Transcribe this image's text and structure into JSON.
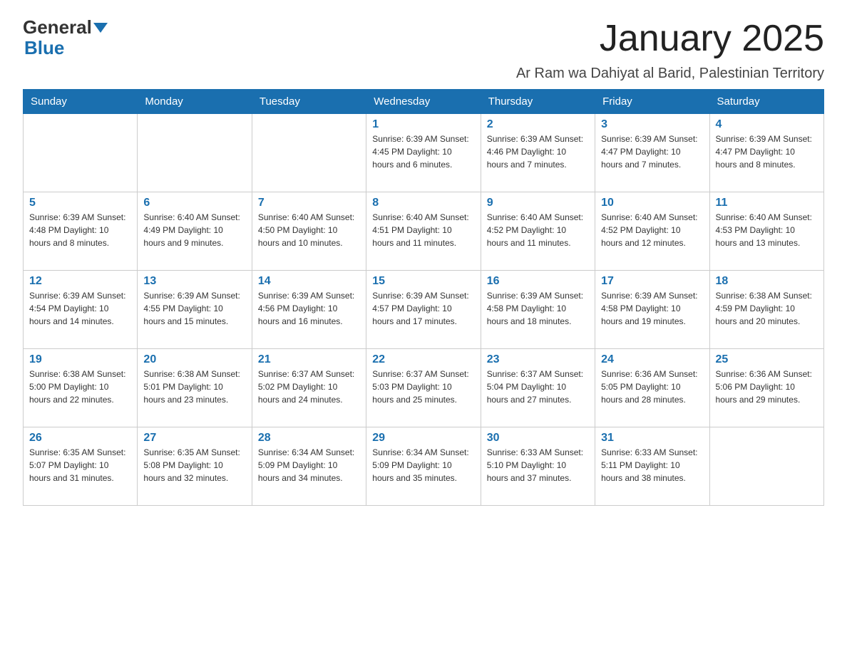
{
  "logo": {
    "general": "General",
    "blue": "Blue"
  },
  "title": "January 2025",
  "subtitle": "Ar Ram wa Dahiyat al Barid, Palestinian Territory",
  "days_of_week": [
    "Sunday",
    "Monday",
    "Tuesday",
    "Wednesday",
    "Thursday",
    "Friday",
    "Saturday"
  ],
  "weeks": [
    [
      {
        "day": "",
        "info": ""
      },
      {
        "day": "",
        "info": ""
      },
      {
        "day": "",
        "info": ""
      },
      {
        "day": "1",
        "info": "Sunrise: 6:39 AM\nSunset: 4:45 PM\nDaylight: 10 hours and 6 minutes."
      },
      {
        "day": "2",
        "info": "Sunrise: 6:39 AM\nSunset: 4:46 PM\nDaylight: 10 hours and 7 minutes."
      },
      {
        "day": "3",
        "info": "Sunrise: 6:39 AM\nSunset: 4:47 PM\nDaylight: 10 hours and 7 minutes."
      },
      {
        "day": "4",
        "info": "Sunrise: 6:39 AM\nSunset: 4:47 PM\nDaylight: 10 hours and 8 minutes."
      }
    ],
    [
      {
        "day": "5",
        "info": "Sunrise: 6:39 AM\nSunset: 4:48 PM\nDaylight: 10 hours and 8 minutes."
      },
      {
        "day": "6",
        "info": "Sunrise: 6:40 AM\nSunset: 4:49 PM\nDaylight: 10 hours and 9 minutes."
      },
      {
        "day": "7",
        "info": "Sunrise: 6:40 AM\nSunset: 4:50 PM\nDaylight: 10 hours and 10 minutes."
      },
      {
        "day": "8",
        "info": "Sunrise: 6:40 AM\nSunset: 4:51 PM\nDaylight: 10 hours and 11 minutes."
      },
      {
        "day": "9",
        "info": "Sunrise: 6:40 AM\nSunset: 4:52 PM\nDaylight: 10 hours and 11 minutes."
      },
      {
        "day": "10",
        "info": "Sunrise: 6:40 AM\nSunset: 4:52 PM\nDaylight: 10 hours and 12 minutes."
      },
      {
        "day": "11",
        "info": "Sunrise: 6:40 AM\nSunset: 4:53 PM\nDaylight: 10 hours and 13 minutes."
      }
    ],
    [
      {
        "day": "12",
        "info": "Sunrise: 6:39 AM\nSunset: 4:54 PM\nDaylight: 10 hours and 14 minutes."
      },
      {
        "day": "13",
        "info": "Sunrise: 6:39 AM\nSunset: 4:55 PM\nDaylight: 10 hours and 15 minutes."
      },
      {
        "day": "14",
        "info": "Sunrise: 6:39 AM\nSunset: 4:56 PM\nDaylight: 10 hours and 16 minutes."
      },
      {
        "day": "15",
        "info": "Sunrise: 6:39 AM\nSunset: 4:57 PM\nDaylight: 10 hours and 17 minutes."
      },
      {
        "day": "16",
        "info": "Sunrise: 6:39 AM\nSunset: 4:58 PM\nDaylight: 10 hours and 18 minutes."
      },
      {
        "day": "17",
        "info": "Sunrise: 6:39 AM\nSunset: 4:58 PM\nDaylight: 10 hours and 19 minutes."
      },
      {
        "day": "18",
        "info": "Sunrise: 6:38 AM\nSunset: 4:59 PM\nDaylight: 10 hours and 20 minutes."
      }
    ],
    [
      {
        "day": "19",
        "info": "Sunrise: 6:38 AM\nSunset: 5:00 PM\nDaylight: 10 hours and 22 minutes."
      },
      {
        "day": "20",
        "info": "Sunrise: 6:38 AM\nSunset: 5:01 PM\nDaylight: 10 hours and 23 minutes."
      },
      {
        "day": "21",
        "info": "Sunrise: 6:37 AM\nSunset: 5:02 PM\nDaylight: 10 hours and 24 minutes."
      },
      {
        "day": "22",
        "info": "Sunrise: 6:37 AM\nSunset: 5:03 PM\nDaylight: 10 hours and 25 minutes."
      },
      {
        "day": "23",
        "info": "Sunrise: 6:37 AM\nSunset: 5:04 PM\nDaylight: 10 hours and 27 minutes."
      },
      {
        "day": "24",
        "info": "Sunrise: 6:36 AM\nSunset: 5:05 PM\nDaylight: 10 hours and 28 minutes."
      },
      {
        "day": "25",
        "info": "Sunrise: 6:36 AM\nSunset: 5:06 PM\nDaylight: 10 hours and 29 minutes."
      }
    ],
    [
      {
        "day": "26",
        "info": "Sunrise: 6:35 AM\nSunset: 5:07 PM\nDaylight: 10 hours and 31 minutes."
      },
      {
        "day": "27",
        "info": "Sunrise: 6:35 AM\nSunset: 5:08 PM\nDaylight: 10 hours and 32 minutes."
      },
      {
        "day": "28",
        "info": "Sunrise: 6:34 AM\nSunset: 5:09 PM\nDaylight: 10 hours and 34 minutes."
      },
      {
        "day": "29",
        "info": "Sunrise: 6:34 AM\nSunset: 5:09 PM\nDaylight: 10 hours and 35 minutes."
      },
      {
        "day": "30",
        "info": "Sunrise: 6:33 AM\nSunset: 5:10 PM\nDaylight: 10 hours and 37 minutes."
      },
      {
        "day": "31",
        "info": "Sunrise: 6:33 AM\nSunset: 5:11 PM\nDaylight: 10 hours and 38 minutes."
      },
      {
        "day": "",
        "info": ""
      }
    ]
  ]
}
